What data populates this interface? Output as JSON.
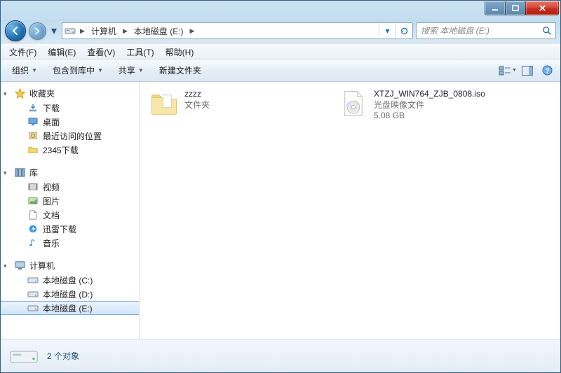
{
  "window": {
    "controls": {
      "min": "min",
      "max": "max",
      "close": "close"
    }
  },
  "nav": {
    "breadcrumb": {
      "icon": "drive-icon",
      "segments": [
        "计算机",
        "本地磁盘 (E:)"
      ]
    },
    "search_placeholder": "搜索 本地磁盘 (E:)"
  },
  "menu": {
    "file": "文件(F)",
    "edit": "编辑(E)",
    "view": "查看(V)",
    "tools": "工具(T)",
    "help": "帮助(H)"
  },
  "toolbar": {
    "organize": "组织",
    "include": "包含到库中",
    "share": "共享",
    "newfolder": "新建文件夹"
  },
  "sidebar": {
    "favorites": {
      "label": "收藏夹",
      "items": [
        "下载",
        "桌面",
        "最近访问的位置",
        "2345下载"
      ]
    },
    "libraries": {
      "label": "库",
      "items": [
        "视频",
        "图片",
        "文档",
        "迅雷下载",
        "音乐"
      ]
    },
    "computer": {
      "label": "计算机",
      "items": [
        "本地磁盘 (C:)",
        "本地磁盘 (D:)",
        "本地磁盘 (E:)"
      ],
      "selected_index": 2
    }
  },
  "files": [
    {
      "name": "zzzz",
      "type_label": "文件夹",
      "kind": "folder"
    },
    {
      "name": "XTZJ_WIN764_ZJB_0808.iso",
      "type_label": "光盘映像文件",
      "size": "5.08 GB",
      "kind": "iso"
    }
  ],
  "details": {
    "count_label": "2 个对象"
  }
}
